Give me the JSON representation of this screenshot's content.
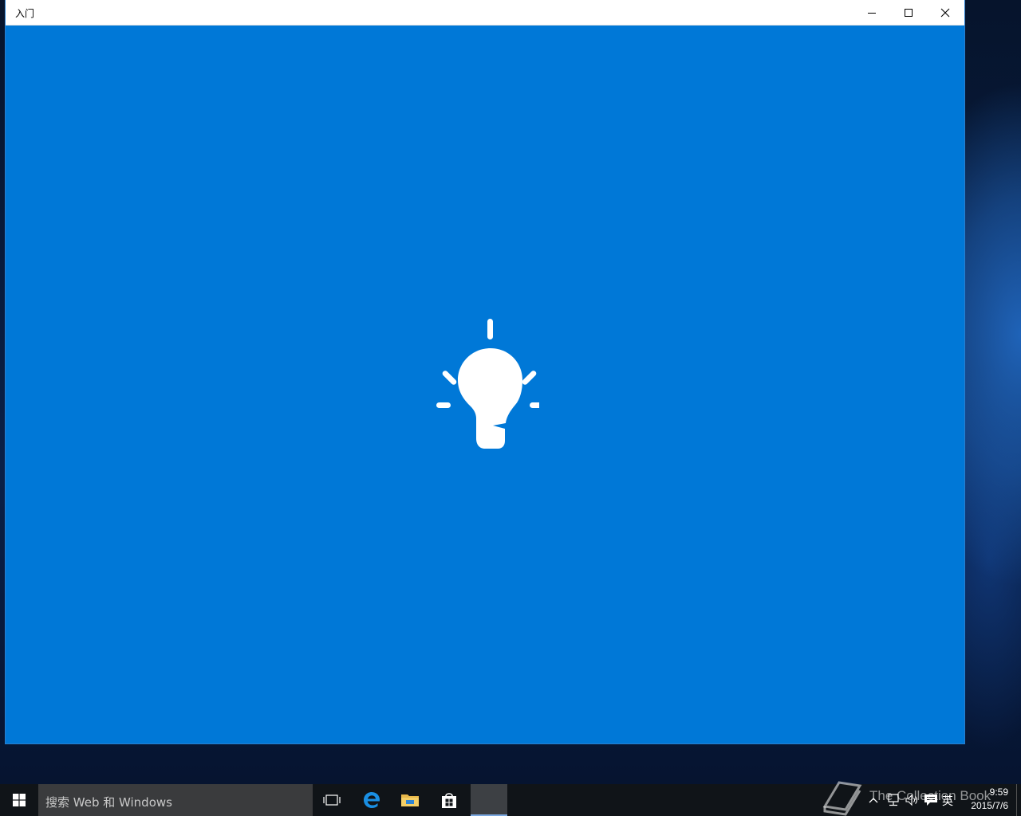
{
  "window": {
    "title": "入门",
    "buttons": {
      "minimize": "minimize",
      "maximize": "maximize",
      "close": "close"
    },
    "content_background": "#0078d7",
    "splash_icon": "lightbulb-icon"
  },
  "taskbar": {
    "search_placeholder": "搜索 Web 和 Windows",
    "pinned": [
      "task-view-icon",
      "edge-icon",
      "file-explorer-icon",
      "store-icon"
    ],
    "active_app": "getting-started"
  },
  "tray": {
    "ime": "英",
    "time": "9:59",
    "date": "2015/7/6"
  },
  "watermark": {
    "text": "The Collection Book"
  }
}
